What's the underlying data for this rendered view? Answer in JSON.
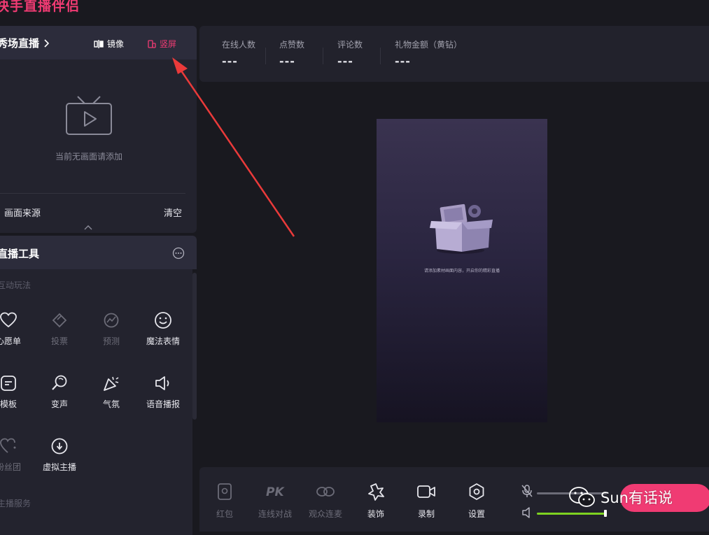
{
  "app": {
    "title": "快手直播伴侣"
  },
  "live_settings": {
    "mode_label": "秀场直播",
    "mirror_label": "镜像",
    "portrait_label": "竖屏",
    "empty_text": "当前无画面请添加",
    "source_label": "画面来源",
    "clear_label": "清空"
  },
  "live_tools": {
    "title": "直播工具",
    "section_interactive": "互动玩法",
    "items": [
      {
        "label": "心愿单",
        "icon": "heart-icon",
        "enabled": true
      },
      {
        "label": "投票",
        "icon": "vote-icon",
        "enabled": false
      },
      {
        "label": "预测",
        "icon": "predict-icon",
        "enabled": false
      },
      {
        "label": "魔法表情",
        "icon": "smile-icon",
        "enabled": true
      },
      {
        "label": "模板",
        "icon": "template-icon",
        "enabled": true
      },
      {
        "label": "变声",
        "icon": "voice-change-icon",
        "enabled": true
      },
      {
        "label": "气氛",
        "icon": "party-icon",
        "enabled": true
      },
      {
        "label": "语音播报",
        "icon": "speaker-icon",
        "enabled": true
      },
      {
        "label": "粉丝团",
        "icon": "fan-heart-icon",
        "enabled": false
      },
      {
        "label": "虚拟主播",
        "icon": "virtual-anchor-icon",
        "enabled": true
      }
    ],
    "section_service": "主播服务"
  },
  "stats": [
    {
      "label": "在线人数",
      "value": "---"
    },
    {
      "label": "点赞数",
      "value": "---"
    },
    {
      "label": "评论数",
      "value": "---"
    },
    {
      "label": "礼物金额（黄钻）",
      "value": "---"
    }
  ],
  "preview": {
    "hint": "请添加素材画面内容，开启你的精彩直播"
  },
  "bottom_toolbar": {
    "items": [
      {
        "label": "红包",
        "icon": "red-packet-icon",
        "enabled": false
      },
      {
        "label": "连线对战",
        "icon": "pk-icon",
        "enabled": false
      },
      {
        "label": "观众连麦",
        "icon": "link-icon",
        "enabled": false
      },
      {
        "label": "装饰",
        "icon": "decoration-icon",
        "enabled": true
      },
      {
        "label": "录制",
        "icon": "record-icon",
        "enabled": true
      },
      {
        "label": "设置",
        "icon": "settings-icon",
        "enabled": true
      }
    ],
    "mic_level": 0.0,
    "speaker_level": 1.0
  },
  "watermark": {
    "text": "Sun有话说"
  },
  "colors": {
    "accent": "#f03b73",
    "panel": "#23232e",
    "header": "#2c2c3b",
    "background": "#19191f",
    "volume": "#7ed321"
  }
}
